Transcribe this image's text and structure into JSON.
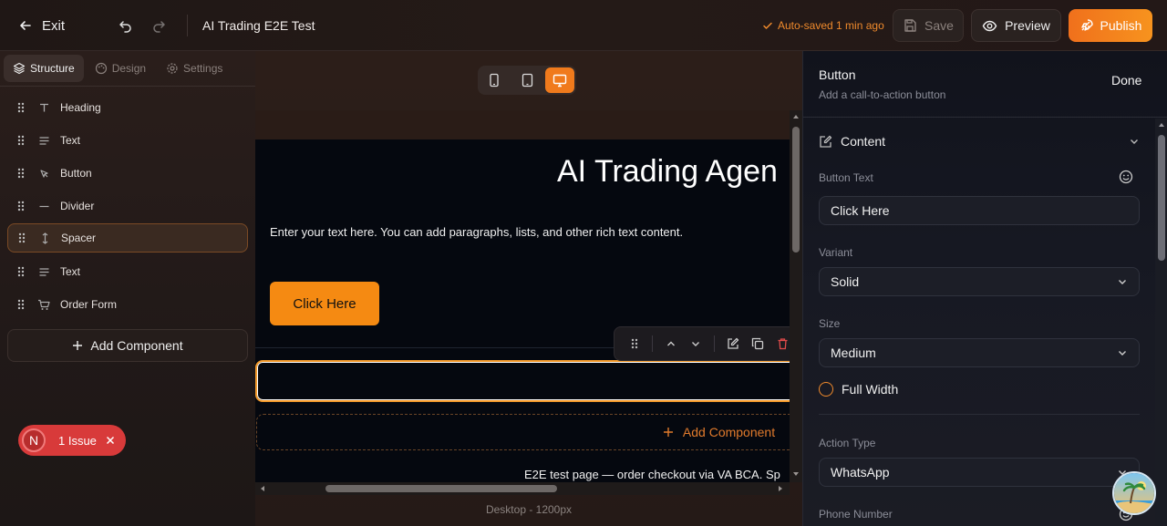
{
  "topbar": {
    "exit_label": "Exit",
    "page_title": "AI Trading E2E Test",
    "autosave": "Auto-saved 1 min ago",
    "save_label": "Save",
    "preview_label": "Preview",
    "publish_label": "Publish"
  },
  "left_panel": {
    "tabs": [
      {
        "label": "Structure",
        "icon": "layers-icon",
        "active": true
      },
      {
        "label": "Design",
        "icon": "palette-icon",
        "active": false
      },
      {
        "label": "Settings",
        "icon": "gear-icon",
        "active": false
      }
    ],
    "components": [
      {
        "label": "Heading",
        "icon": "heading-icon",
        "selected": false
      },
      {
        "label": "Text",
        "icon": "text-icon",
        "selected": false
      },
      {
        "label": "Button",
        "icon": "cursor-icon",
        "selected": false
      },
      {
        "label": "Divider",
        "icon": "divider-icon",
        "selected": false
      },
      {
        "label": "Spacer",
        "icon": "spacer-icon",
        "selected": true
      },
      {
        "label": "Text",
        "icon": "text-icon",
        "selected": false
      },
      {
        "label": "Order Form",
        "icon": "cart-icon",
        "selected": false
      }
    ],
    "add_component_label": "Add Component",
    "issue": {
      "avatar_letter": "N",
      "label": "1 Issue"
    }
  },
  "canvas": {
    "devices": [
      "mobile",
      "tablet",
      "desktop"
    ],
    "active_device": "desktop",
    "heading": "AI Trading Agen",
    "paragraph": "Enter your text here. You can add paragraphs, lists, and other rich text content.",
    "button_label": "Click Here",
    "add_component_label": "Add Component",
    "footer_text": "E2E test page — order checkout via VA BCA. Sp",
    "device_label": "Desktop - 1200px"
  },
  "right_panel": {
    "title": "Button",
    "subtitle": "Add a call-to-action button",
    "done_label": "Done",
    "section_label": "Content",
    "fields": {
      "button_text_label": "Button Text",
      "button_text_value": "Click Here",
      "variant_label": "Variant",
      "variant_value": "Solid",
      "size_label": "Size",
      "size_value": "Medium",
      "full_width_label": "Full Width",
      "action_type_label": "Action Type",
      "action_type_value": "WhatsApp",
      "phone_label": "Phone Number"
    }
  },
  "colors": {
    "accent": "#f58a12",
    "danger": "#d83a3a"
  }
}
